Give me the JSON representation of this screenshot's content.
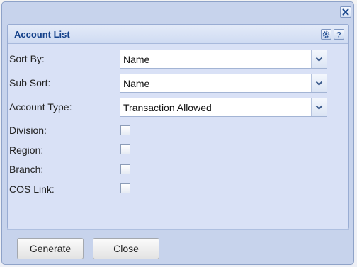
{
  "dialog": {
    "panel_title": "Account List",
    "icons": {
      "close": "close-icon",
      "settings": "gear-icon",
      "help": "help-icon"
    }
  },
  "form": {
    "sort_by": {
      "label": "Sort By:",
      "value": "Name"
    },
    "sub_sort": {
      "label": "Sub Sort:",
      "value": "Name"
    },
    "account_type": {
      "label": "Account Type:",
      "value": "Transaction Allowed"
    },
    "checkboxes": [
      {
        "label": "Division:",
        "checked": false
      },
      {
        "label": "Region:",
        "checked": false
      },
      {
        "label": "Branch:",
        "checked": false
      },
      {
        "label": "COS Link:",
        "checked": false
      }
    ]
  },
  "footer": {
    "generate_label": "Generate",
    "close_label": "Close"
  },
  "colors": {
    "title": "#15428b",
    "dialog_bg": "#c7d3ec",
    "panel_bg": "#d9e1f6"
  }
}
